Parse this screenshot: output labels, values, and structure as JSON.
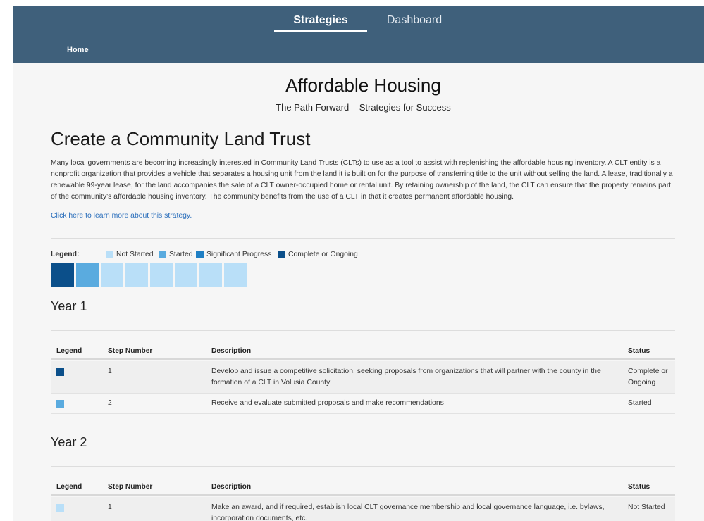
{
  "nav": {
    "tabs": [
      {
        "label": "Strategies",
        "active": true
      },
      {
        "label": "Dashboard",
        "active": false
      }
    ],
    "breadcrumb": "Home"
  },
  "header": {
    "title": "Affordable Housing",
    "subtitle": "The Path Forward – Strategies for Success"
  },
  "strategy": {
    "title": "Create a Community Land Trust",
    "description": "Many local governments are becoming increasingly interested in Community Land Trusts (CLTs) to use as a tool to assist with replenishing the affordable housing inventory. A CLT entity is a nonprofit organization that provides a vehicle that separates a housing unit from the land it is built on for the purpose of transferring title to the unit without selling the land. A lease, traditionally a renewable 99-year lease, for the land accompanies the sale of a CLT owner-occupied home or rental unit. By retaining ownership of the land, the CLT can ensure that the property remains part of the community's affordable housing inventory. The community benefits from the use of a CLT in that it creates permanent affordable housing.",
    "learn_more": "Click here to learn more about this strategy."
  },
  "legend": {
    "label": "Legend:",
    "items": [
      {
        "label": "Not Started",
        "color": "#b9dff8"
      },
      {
        "label": "Started",
        "color": "#5aabdf"
      },
      {
        "label": "Significant Progress",
        "color": "#1f7fc4"
      },
      {
        "label": "Complete or Ongoing",
        "color": "#0b4f8a"
      }
    ]
  },
  "progress": [
    "#0b4f8a",
    "#5aabdf",
    "#b9dff8",
    "#b9dff8",
    "#b9dff8",
    "#b9dff8",
    "#b9dff8",
    "#b9dff8"
  ],
  "columns": {
    "legend": "Legend",
    "step": "Step Number",
    "description": "Description",
    "status": "Status"
  },
  "years": [
    {
      "title": "Year 1",
      "rows": [
        {
          "color": "#0b4f8a",
          "step": "1",
          "description": "Develop and issue a competitive solicitation, seeking proposals from organizations that will partner with the county in the formation of a CLT in Volusia County",
          "status": "Complete or Ongoing"
        },
        {
          "color": "#5aabdf",
          "step": "2",
          "description": "Receive and evaluate submitted proposals and make recommendations",
          "status": "Started"
        }
      ]
    },
    {
      "title": "Year 2",
      "rows": [
        {
          "color": "#b9dff8",
          "step": "1",
          "description": "Make an award, and if required, establish local CLT governance membership and local governance language, i.e. bylaws, incorporation documents, etc.",
          "status": "Not Started"
        }
      ]
    }
  ]
}
